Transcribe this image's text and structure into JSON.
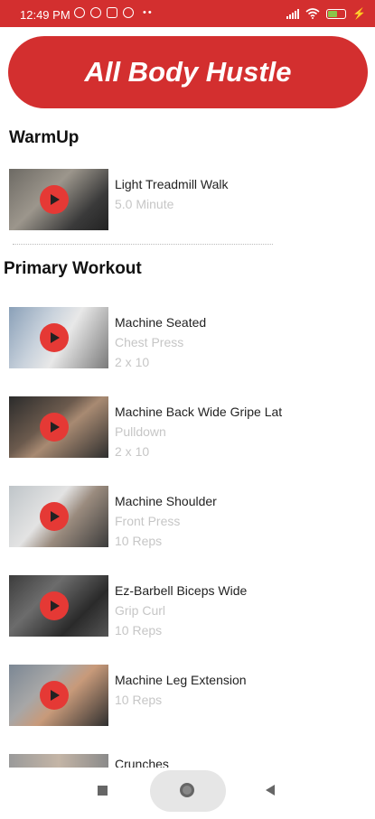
{
  "status": {
    "time": "12:49 PM",
    "battery_percent": 60
  },
  "header": {
    "title": "All Body Hustle"
  },
  "sections": {
    "warmup": {
      "title": "WarmUp",
      "items": [
        {
          "name": "Light Treadmill Walk",
          "line2": "5.0 Minute",
          "line3": ""
        }
      ]
    },
    "primary": {
      "title": "Primary Workout",
      "items": [
        {
          "name": "Machine Seated",
          "line2": "Chest Press",
          "line3": "2 x 10"
        },
        {
          "name": "Machine Back Wide Gripe Lat",
          "line2": "Pulldown",
          "line3": "2 x 10"
        },
        {
          "name": "Machine Shoulder",
          "line2": "Front Press",
          "line3": "10 Reps"
        },
        {
          "name": "Ez-Barbell Biceps Wide",
          "line2": "Grip Curl",
          "line3": "10 Reps"
        },
        {
          "name": "Machine Leg Extension",
          "line2": "10 Reps",
          "line3": ""
        },
        {
          "name": "Crunches",
          "line2": "",
          "line3": ""
        }
      ]
    }
  },
  "icons": {
    "play": "play-icon",
    "recents": "recents-square-icon",
    "home": "home-circle-icon",
    "back": "back-triangle-icon"
  },
  "colors": {
    "accent": "#d32f2f",
    "play": "#e53935",
    "subtext": "#c6c6c6"
  }
}
